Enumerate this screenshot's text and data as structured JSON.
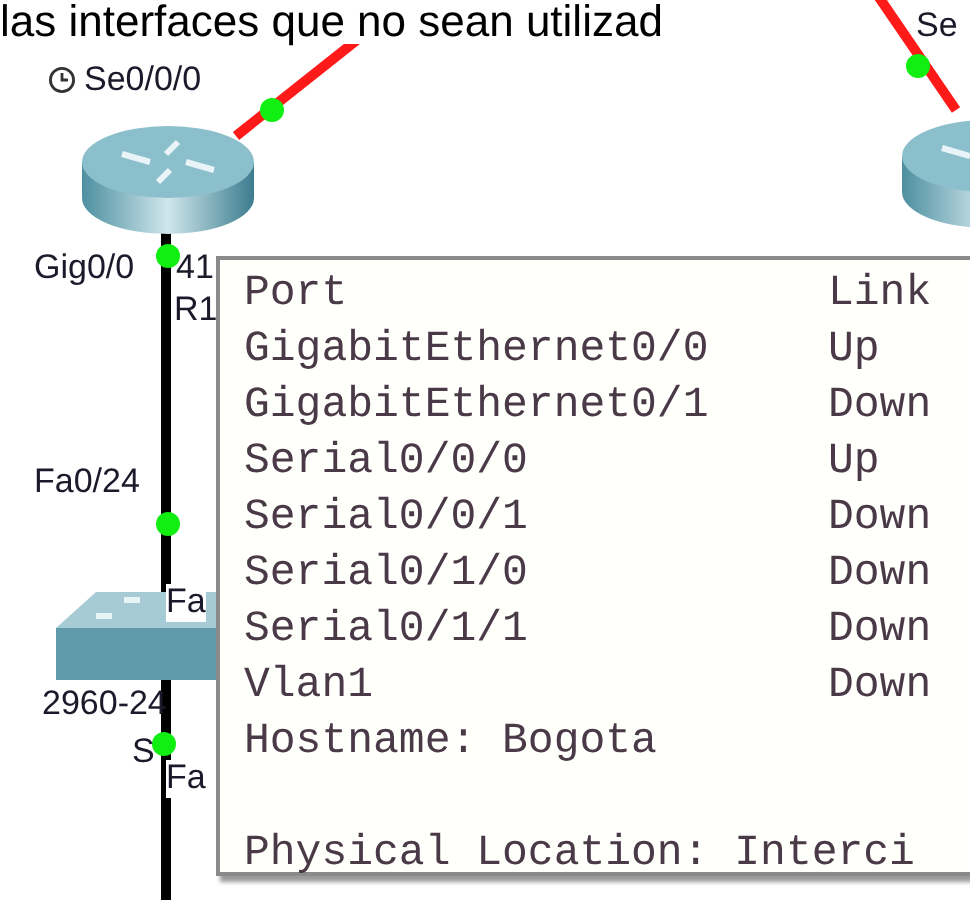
{
  "caption": "las interfaces que no sean utilizad",
  "labels": [
    {
      "text": "Se0/0/0",
      "kind": "clocked"
    },
    {
      "text": "Se",
      "kind": "plain"
    },
    {
      "text": "Gig0/0",
      "kind": "plain"
    },
    {
      "text": "41",
      "kind": "plain"
    },
    {
      "text": "R1",
      "kind": "plain"
    },
    {
      "text": "Fa0/24",
      "kind": "plain"
    },
    {
      "text": "Fa",
      "kind": "boxed"
    },
    {
      "text": "2960-24",
      "kind": "plain"
    },
    {
      "text": "S",
      "kind": "plain"
    },
    {
      "text": "Fa",
      "kind": "boxed"
    }
  ],
  "devices": [
    {
      "kind": "router"
    },
    {
      "kind": "router"
    },
    {
      "kind": "switch"
    }
  ],
  "tooltip": {
    "header": {
      "port": "Port",
      "link": "Link"
    },
    "ports": [
      {
        "port": "GigabitEthernet0/0",
        "link": "Up"
      },
      {
        "port": "GigabitEthernet0/1",
        "link": "Down"
      },
      {
        "port": "Serial0/0/0",
        "link": "Up"
      },
      {
        "port": "Serial0/0/1",
        "link": "Down"
      },
      {
        "port": "Serial0/1/0",
        "link": "Down"
      },
      {
        "port": "Serial0/1/1",
        "link": "Down"
      },
      {
        "port": "Vlan1",
        "link": "Down"
      }
    ],
    "hostname": "Hostname: Bogota",
    "location": "Physical Location: Interci"
  }
}
